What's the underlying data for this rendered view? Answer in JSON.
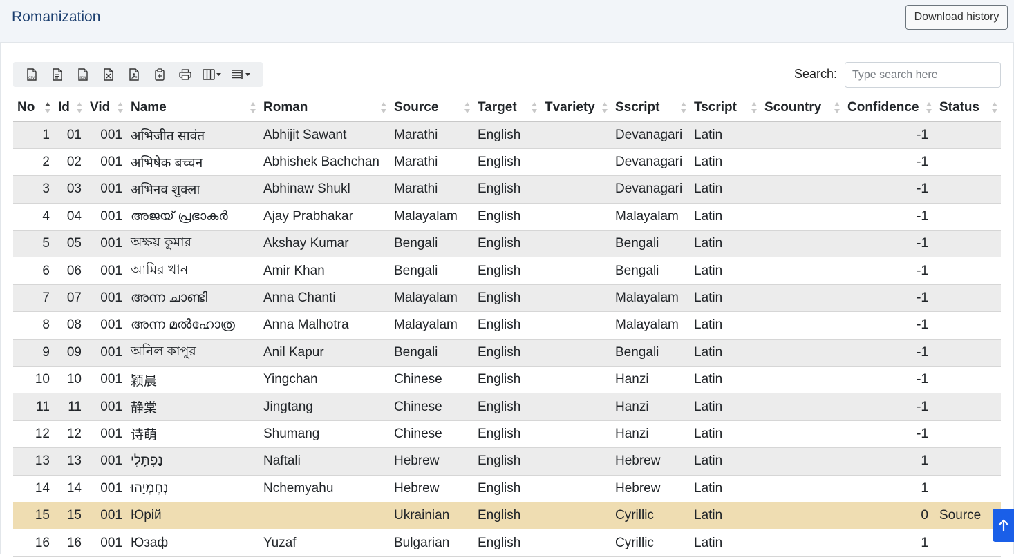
{
  "header": {
    "title": "Romanization",
    "download_label": "Download history"
  },
  "toolbar": {
    "buttons": [
      {
        "name": "csv-export-button",
        "icon": "csv-file-icon"
      },
      {
        "name": "text-export-button",
        "icon": "text-file-icon"
      },
      {
        "name": "json-export-button",
        "icon": "json-file-icon"
      },
      {
        "name": "excel-export-button",
        "icon": "excel-file-icon"
      },
      {
        "name": "pdf-export-button",
        "icon": "pdf-file-icon"
      },
      {
        "name": "clipboard-copy-button",
        "icon": "clipboard-icon"
      },
      {
        "name": "print-button",
        "icon": "printer-icon"
      },
      {
        "name": "column-visibility-button",
        "icon": "columns-icon"
      },
      {
        "name": "page-length-button",
        "icon": "list-icon"
      }
    ]
  },
  "search": {
    "label": "Search:",
    "placeholder": "Type search here",
    "value": ""
  },
  "table": {
    "columns": [
      "No",
      "Id",
      "Vid",
      "Name",
      "Roman",
      "Source",
      "Target",
      "Tvariety",
      "Sscript",
      "Tscript",
      "Scountry",
      "Confidence",
      "Status"
    ],
    "sorted_column": "No",
    "sort_direction": "ascending",
    "highlighted_row": 15,
    "rows": [
      {
        "no": "1",
        "id": "01",
        "vid": "001",
        "name": "अभिजीत सावंत",
        "roman": "Abhijit Sawant",
        "source": "Marathi",
        "target": "English",
        "tvariety": "",
        "sscript": "Devanagari",
        "tscript": "Latin",
        "scountry": "",
        "confidence": "-1",
        "status": ""
      },
      {
        "no": "2",
        "id": "02",
        "vid": "001",
        "name": "अभिषेक बच्चन",
        "roman": "Abhishek Bachchan",
        "source": "Marathi",
        "target": "English",
        "tvariety": "",
        "sscript": "Devanagari",
        "tscript": "Latin",
        "scountry": "",
        "confidence": "-1",
        "status": ""
      },
      {
        "no": "3",
        "id": "03",
        "vid": "001",
        "name": "अभिनव शुक्ला",
        "roman": "Abhinaw Shukl",
        "source": "Marathi",
        "target": "English",
        "tvariety": "",
        "sscript": "Devanagari",
        "tscript": "Latin",
        "scountry": "",
        "confidence": "-1",
        "status": ""
      },
      {
        "no": "4",
        "id": "04",
        "vid": "001",
        "name": "അജയ് പ്രഭാകർ",
        "roman": "Ajay Prabhakar",
        "source": "Malayalam",
        "target": "English",
        "tvariety": "",
        "sscript": "Malayalam",
        "tscript": "Latin",
        "scountry": "",
        "confidence": "-1",
        "status": ""
      },
      {
        "no": "5",
        "id": "05",
        "vid": "001",
        "name": "অক্ষয় কুমার",
        "roman": "Akshay Kumar",
        "source": "Bengali",
        "target": "English",
        "tvariety": "",
        "sscript": "Bengali",
        "tscript": "Latin",
        "scountry": "",
        "confidence": "-1",
        "status": ""
      },
      {
        "no": "6",
        "id": "06",
        "vid": "001",
        "name": "আমির খান",
        "roman": "Amir Khan",
        "source": "Bengali",
        "target": "English",
        "tvariety": "",
        "sscript": "Bengali",
        "tscript": "Latin",
        "scountry": "",
        "confidence": "-1",
        "status": ""
      },
      {
        "no": "7",
        "id": "07",
        "vid": "001",
        "name": "അന്ന ചാണ്ടി",
        "roman": "Anna Chanti",
        "source": "Malayalam",
        "target": "English",
        "tvariety": "",
        "sscript": "Malayalam",
        "tscript": "Latin",
        "scountry": "",
        "confidence": "-1",
        "status": ""
      },
      {
        "no": "8",
        "id": "08",
        "vid": "001",
        "name": "അന്ന മൽഹോത്ര",
        "roman": "Anna Malhotra",
        "source": "Malayalam",
        "target": "English",
        "tvariety": "",
        "sscript": "Malayalam",
        "tscript": "Latin",
        "scountry": "",
        "confidence": "-1",
        "status": ""
      },
      {
        "no": "9",
        "id": "09",
        "vid": "001",
        "name": "অনিল কাপুর",
        "roman": "Anil Kapur",
        "source": "Bengali",
        "target": "English",
        "tvariety": "",
        "sscript": "Bengali",
        "tscript": "Latin",
        "scountry": "",
        "confidence": "-1",
        "status": ""
      },
      {
        "no": "10",
        "id": "10",
        "vid": "001",
        "name": "颖晨",
        "roman": "Yingchan",
        "source": "Chinese",
        "target": "English",
        "tvariety": "",
        "sscript": "Hanzi",
        "tscript": "Latin",
        "scountry": "",
        "confidence": "-1",
        "status": ""
      },
      {
        "no": "11",
        "id": "11",
        "vid": "001",
        "name": "静棠",
        "roman": "Jingtang",
        "source": "Chinese",
        "target": "English",
        "tvariety": "",
        "sscript": "Hanzi",
        "tscript": "Latin",
        "scountry": "",
        "confidence": "-1",
        "status": ""
      },
      {
        "no": "12",
        "id": "12",
        "vid": "001",
        "name": "诗萌",
        "roman": "Shumang",
        "source": "Chinese",
        "target": "English",
        "tvariety": "",
        "sscript": "Hanzi",
        "tscript": "Latin",
        "scountry": "",
        "confidence": "-1",
        "status": ""
      },
      {
        "no": "13",
        "id": "13",
        "vid": "001",
        "name": "נַפְתָּלִי",
        "roman": "Naftali",
        "source": "Hebrew",
        "target": "English",
        "tvariety": "",
        "sscript": "Hebrew",
        "tscript": "Latin",
        "scountry": "",
        "confidence": "1",
        "status": ""
      },
      {
        "no": "14",
        "id": "14",
        "vid": "001",
        "name": "נְחֶמְיָהוּ",
        "roman": "Nchemyahu",
        "source": "Hebrew",
        "target": "English",
        "tvariety": "",
        "sscript": "Hebrew",
        "tscript": "Latin",
        "scountry": "",
        "confidence": "1",
        "status": ""
      },
      {
        "no": "15",
        "id": "15",
        "vid": "001",
        "name": "Юрій",
        "roman": "",
        "source": "Ukrainian",
        "target": "English",
        "tvariety": "",
        "sscript": "Cyrillic",
        "tscript": "Latin",
        "scountry": "",
        "confidence": "0",
        "status": "Source"
      },
      {
        "no": "16",
        "id": "16",
        "vid": "001",
        "name": "Юзаф",
        "roman": "Yuzaf",
        "source": "Bulgarian",
        "target": "English",
        "tvariety": "",
        "sscript": "Cyrillic",
        "tscript": "Latin",
        "scountry": "",
        "confidence": "1",
        "status": ""
      }
    ]
  },
  "scroll_top": {
    "icon": "arrow-up-icon"
  },
  "colors": {
    "title": "#1a3d6e",
    "odd_row": "#ececec",
    "highlight_row": "#efddb2",
    "scroll_button": "#1a5fe8"
  }
}
